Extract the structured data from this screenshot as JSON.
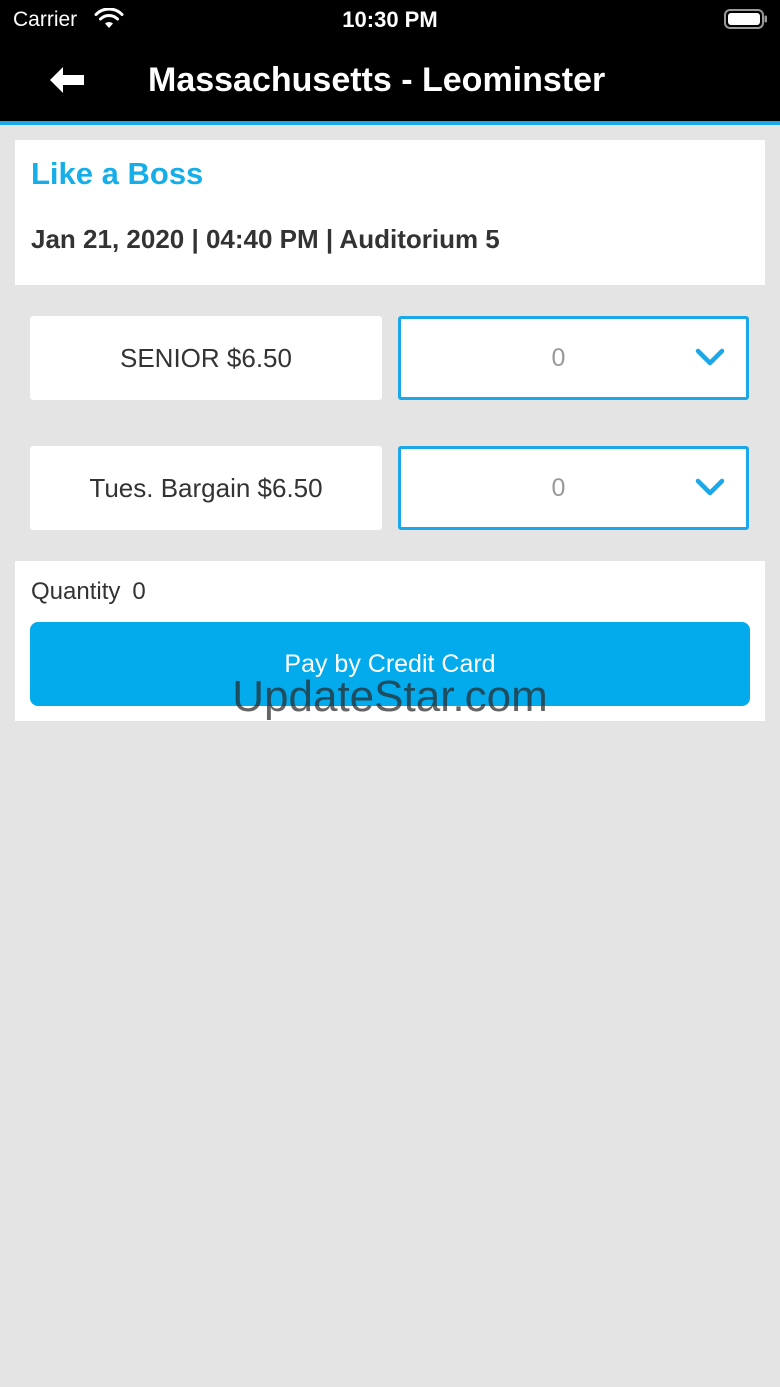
{
  "status_bar": {
    "carrier": "Carrier",
    "time": "10:30 PM"
  },
  "nav": {
    "title": "Massachusetts - Leominster",
    "back_icon": "arrow-left-icon"
  },
  "movie": {
    "title": "Like a Boss",
    "showtime": "Jan 21, 2020 | 04:40 PM | Auditorium 5"
  },
  "tickets": [
    {
      "label": "SENIOR $6.50",
      "quantity": "0"
    },
    {
      "label": "Tues. Bargain $6.50",
      "quantity": "0"
    }
  ],
  "summary": {
    "quantity_label": "Quantity",
    "quantity_value": "0"
  },
  "pay_button_label": "Pay by Credit Card",
  "watermark": "UpdateStar.com",
  "colors": {
    "accent": "#1aa8e8",
    "button": "#03abec",
    "background": "#e4e4e4"
  }
}
